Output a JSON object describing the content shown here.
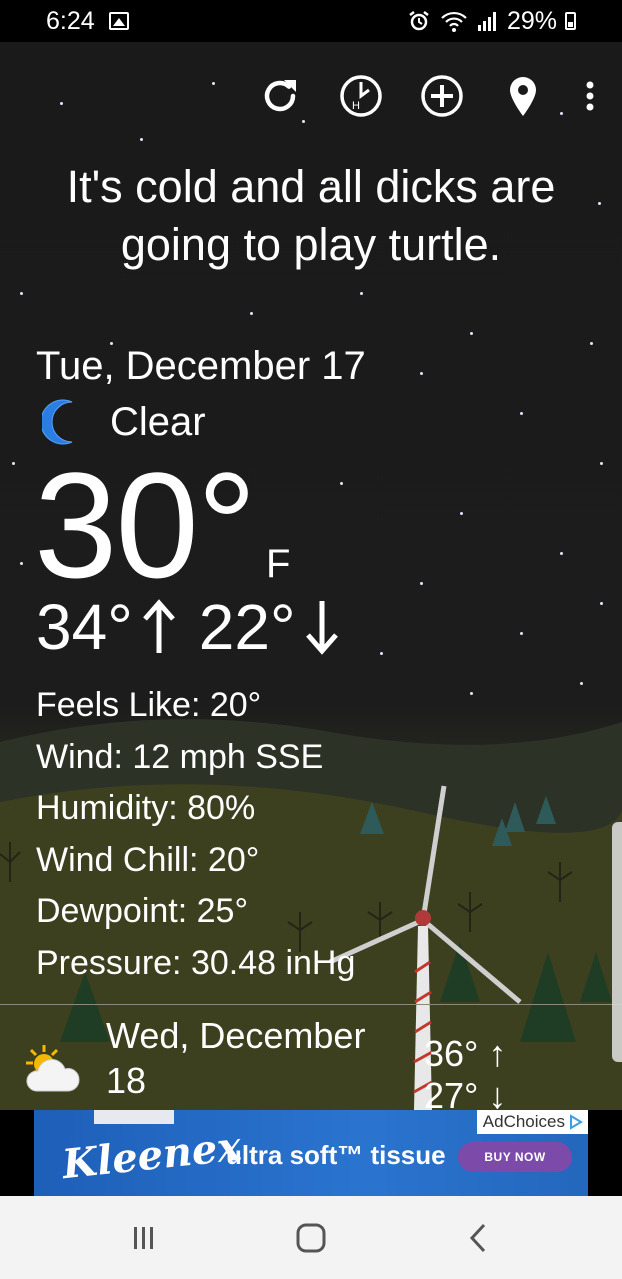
{
  "status_bar": {
    "time": "6:24",
    "battery": "29%"
  },
  "toolbar": {
    "icons": [
      "refresh-icon",
      "history-icon",
      "add-icon",
      "location-pin-icon",
      "more-vert-icon"
    ]
  },
  "quote": "It's cold and all dicks are going to play turtle.",
  "current": {
    "date": "Tue, December 17",
    "condition": "Clear",
    "condition_icon": "moon-icon",
    "temp": "30°",
    "unit": "F",
    "high": "34°",
    "low": "22°"
  },
  "details": {
    "feels_like": "Feels Like: 20°",
    "wind": "Wind: 12 mph SSE",
    "humidity": "Humidity: 80%",
    "wind_chill": "Wind Chill: 20°",
    "dewpoint": "Dewpoint: 25°",
    "pressure": "Pressure: 30.48 inHg"
  },
  "forecast": {
    "date_line1": "Wed, December",
    "date_line2": "18",
    "icon": "partly-cloudy-icon",
    "high": "36°",
    "low": "27°"
  },
  "ad": {
    "brand": "Kleenex",
    "tagline": "ultra soft™ tissue",
    "cta": "BUY NOW",
    "adchoices": "AdChoices"
  },
  "colors": {
    "moon": "#2a7de1",
    "ad_bg": "#2a74cf",
    "cta": "#7c4aa8"
  }
}
